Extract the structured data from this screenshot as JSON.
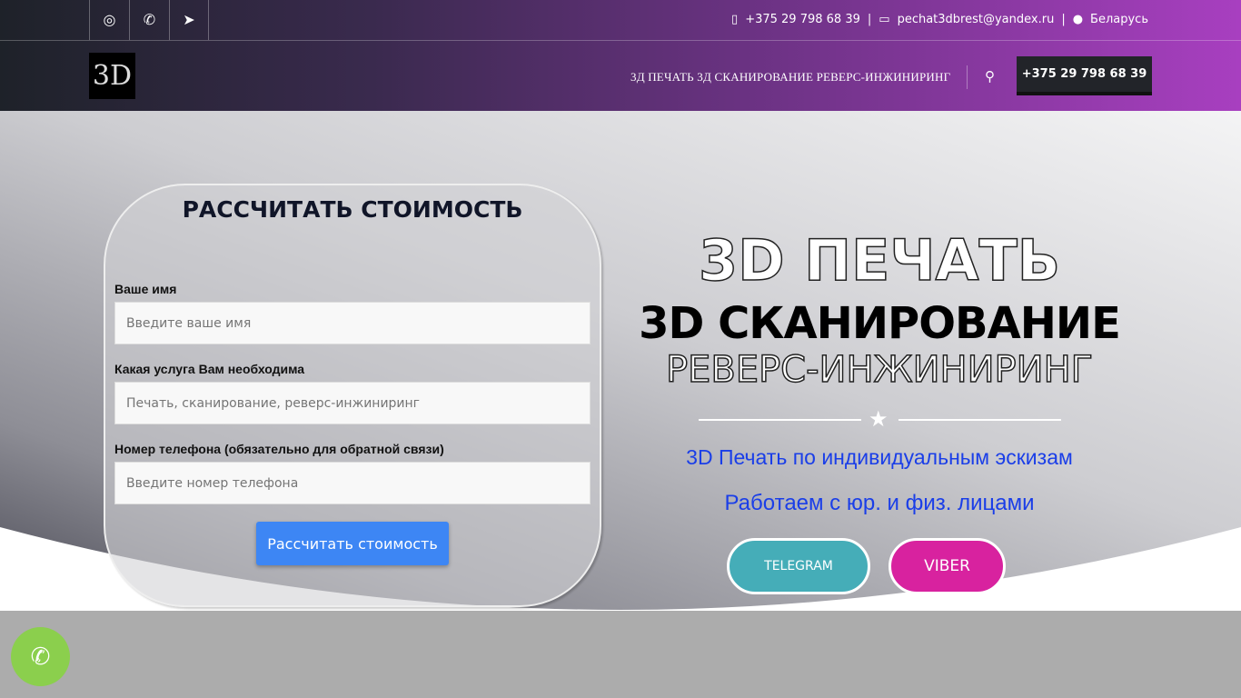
{
  "topbar": {
    "phone": "+375 29 798 68 39",
    "email": "pechat3dbrest@yandex.ru",
    "country": "Беларусь",
    "separator": "|"
  },
  "logo": {
    "text": "3D"
  },
  "nav": {
    "label": "3Д ПЕЧАТЬ 3Д СКАНИРОВАНИЕ РЕВЕРС-ИНЖИНИРИНГ",
    "call_button": "+375 29 798 68 39"
  },
  "form": {
    "title": "РАССЧИТАТЬ СТОИМОСТЬ",
    "fields": [
      {
        "label": "Ваше имя",
        "placeholder": "Введите ваше имя"
      },
      {
        "label": "Какая услуга Вам необходима",
        "placeholder": "Печать, сканирование, реверс-инжиниринг"
      },
      {
        "label": "Номер телефона (обязательно для обратной связи)",
        "placeholder": "Введите номер телефона"
      }
    ],
    "submit": "Рассчитать стоимость"
  },
  "hero": {
    "line1": "3D ПЕЧАТЬ",
    "line2": "3D СКАНИРОВАНИЕ",
    "line3": "РЕВЕРС-ИНЖИНИРИНГ",
    "tagline1": "3D Печать по индивидуальным эскизам",
    "tagline2": "Работаем с юр. и физ. лицами",
    "telegram": "TELEGRAM",
    "viber": "VIBER"
  },
  "colors": {
    "telegram": "#45adb8",
    "viber": "#d8229f",
    "submit": "#3d86f4",
    "fab": "#8bcf4d"
  }
}
